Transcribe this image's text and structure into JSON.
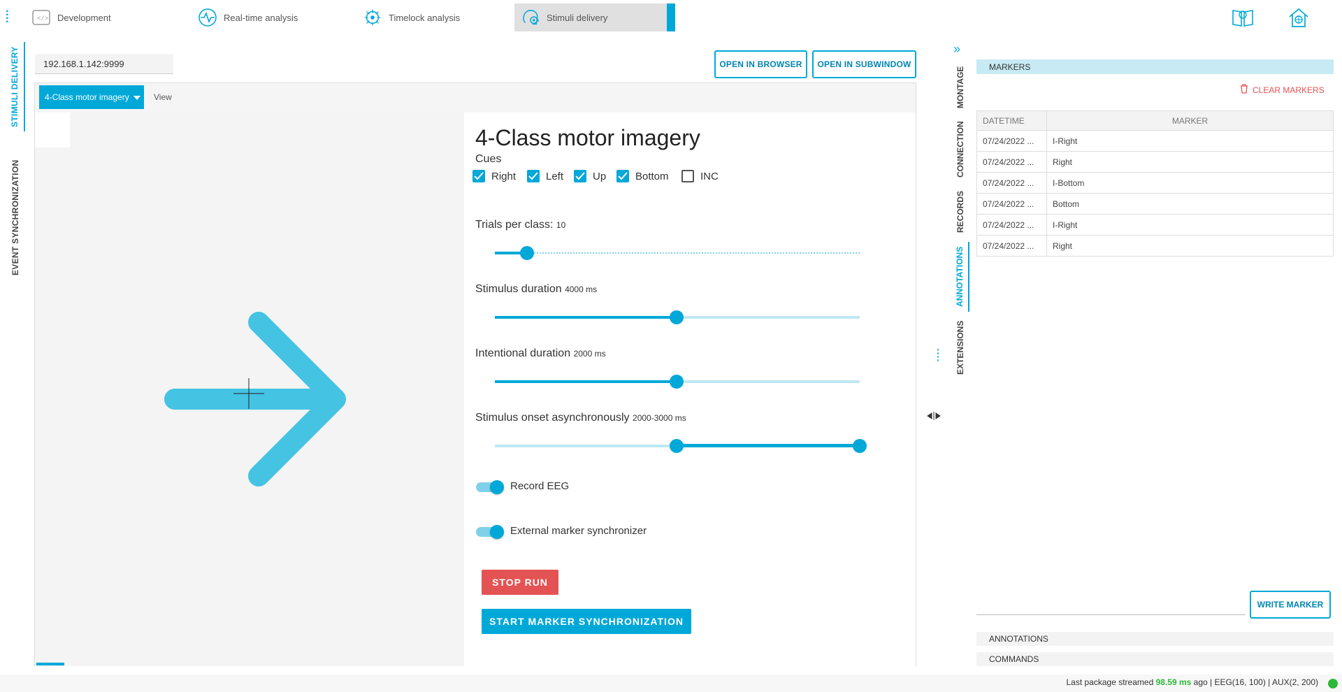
{
  "tabs": [
    {
      "label": "Development",
      "icon": "dev-brain-icon"
    },
    {
      "label": "Real-time analysis",
      "icon": "realtime-icon"
    },
    {
      "label": "Timelock analysis",
      "icon": "timelock-icon"
    },
    {
      "label": "Stimuli delivery",
      "icon": "stimuli-icon"
    }
  ],
  "left_nav": {
    "stimuli_delivery": "STIMULI DELIVERY",
    "event_sync": "EVENT SYNCHRONIZATION"
  },
  "address": {
    "value": "192.168.1.142:9999"
  },
  "buttons": {
    "open_browser": "OPEN IN BROWSER",
    "open_subwindow": "OPEN IN SUBWINDOW"
  },
  "menu": {
    "paradigm": "4-Class motor imagery",
    "view": "View"
  },
  "panel": {
    "title": "4-Class motor imagery",
    "cues_label": "Cues",
    "cues": [
      {
        "label": "Right",
        "checked": true
      },
      {
        "label": "Left",
        "checked": true
      },
      {
        "label": "Up",
        "checked": true
      },
      {
        "label": "Bottom",
        "checked": true
      },
      {
        "label": "INC",
        "checked": false
      }
    ],
    "trials": {
      "label": "Trials per class:",
      "value": "10"
    },
    "stim_duration": {
      "label": "Stimulus duration",
      "value": "4000 ms"
    },
    "intent_duration": {
      "label": "Intentional duration",
      "value": "2000 ms"
    },
    "soa": {
      "label": "Stimulus onset asynchronously",
      "value": "2000-3000 ms"
    },
    "record_eeg": "Record EEG",
    "ext_marker": "External marker synchronizer",
    "stop": "STOP RUN",
    "start_sync": "START MARKER SYNCHRONIZATION"
  },
  "right_nav": [
    "MONTAGE",
    "CONNECTION",
    "RECORDS",
    "ANNOTATIONS",
    "EXTENSIONS"
  ],
  "markers": {
    "header": "MARKERS",
    "clear": "CLEAR MARKERS",
    "columns": [
      "DATETIME",
      "MARKER"
    ],
    "rows": [
      [
        "07/24/2022 ...",
        "I-Right"
      ],
      [
        "07/24/2022 ...",
        "Right"
      ],
      [
        "07/24/2022 ...",
        "I-Bottom"
      ],
      [
        "07/24/2022 ...",
        "Bottom"
      ],
      [
        "07/24/2022 ...",
        "I-Right"
      ],
      [
        "07/24/2022 ...",
        "Right"
      ]
    ],
    "write": "WRITE MARKER",
    "annotations": "ANNOTATIONS",
    "commands": "COMMANDS"
  },
  "status": {
    "prefix": "Last package streamed",
    "latency": "98.59 ms",
    "suffix": "ago | EEG(16, 100) | AUX(2, 200)"
  },
  "colors": {
    "accent": "#00a8d8",
    "danger": "#e45353",
    "ok": "#2eb83a"
  }
}
